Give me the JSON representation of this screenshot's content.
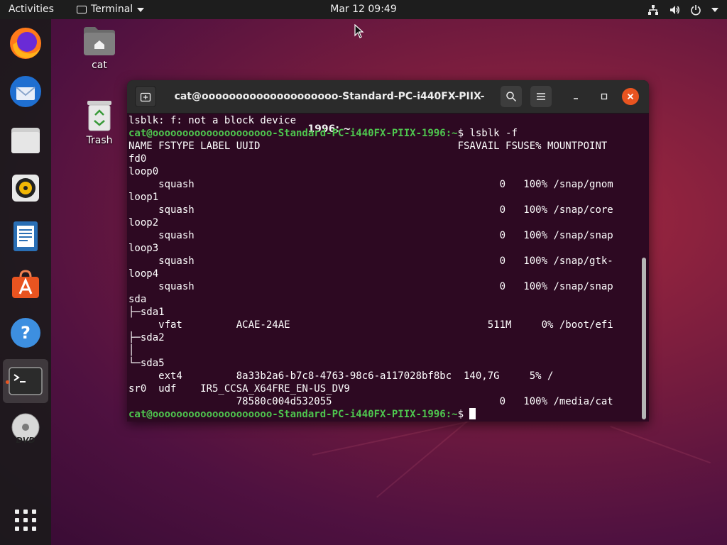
{
  "topbar": {
    "activities": "Activities",
    "app_name": "Terminal",
    "clock": "Mar 12  09:49"
  },
  "desktop": {
    "home_label": "cat",
    "trash_label": "Trash"
  },
  "dock": {
    "items": [
      "firefox-icon",
      "thunderbird-icon",
      "files-icon",
      "rhythmbox-icon",
      "writer-icon",
      "software-icon",
      "help-icon",
      "terminal-icon",
      "dvd-icon",
      "app-grid-icon"
    ],
    "dvd_label": "DVD"
  },
  "terminal": {
    "title": "cat@oooooooooooooooooooo-Standard-PC-i440FX-PIIX-1996: ~",
    "prompt_user": "cat@oooooooooooooooooooo-Standard-PC-i440FX-PIIX-1996",
    "prompt_path": ":~",
    "lines": [
      {
        "text": "lsblk: f: not a block device"
      },
      {
        "prompt": "cat@oooooooooooooooooooo-Standard-PC-i440FX-PIIX-1996:~",
        "text": "$ lsblk -f"
      },
      {
        "text": "NAME FSTYPE LABEL UUID                                 FSAVAIL FSUSE% MOUNTPOINT"
      },
      {
        "text": "fd0"
      },
      {
        "text": "loop0"
      },
      {
        "text": "     squash                                                   0   100% /snap/gnom"
      },
      {
        "text": "loop1"
      },
      {
        "text": "     squash                                                   0   100% /snap/core"
      },
      {
        "text": "loop2"
      },
      {
        "text": "     squash                                                   0   100% /snap/snap"
      },
      {
        "text": "loop3"
      },
      {
        "text": "     squash                                                   0   100% /snap/gtk-"
      },
      {
        "text": "loop4"
      },
      {
        "text": "     squash                                                   0   100% /snap/snap"
      },
      {
        "text": "sda"
      },
      {
        "text": "├─sda1"
      },
      {
        "text": "     vfat         ACAE-24AE                                 511M     0% /boot/efi"
      },
      {
        "text": "├─sda2"
      },
      {
        "text": "│"
      },
      {
        "text": "└─sda5"
      },
      {
        "text": "     ext4         8a33b2a6-b7c8-4763-98c6-a117028bf8bc  140,7G     5% /"
      },
      {
        "text": "sr0  udf    IR5_CCSA_X64FRE_EN-US_DV9"
      },
      {
        "text": "                  78580c004d532055                            0   100% /media/cat"
      },
      {
        "prompt": "cat@oooooooooooooooooooo-Standard-PC-i440FX-PIIX-1996:~",
        "text": "$ ",
        "cursor": true
      }
    ]
  },
  "colors": {
    "accent": "#e95420",
    "prompt_green": "#4ec54e",
    "terminal_bg": "#2d0922"
  }
}
